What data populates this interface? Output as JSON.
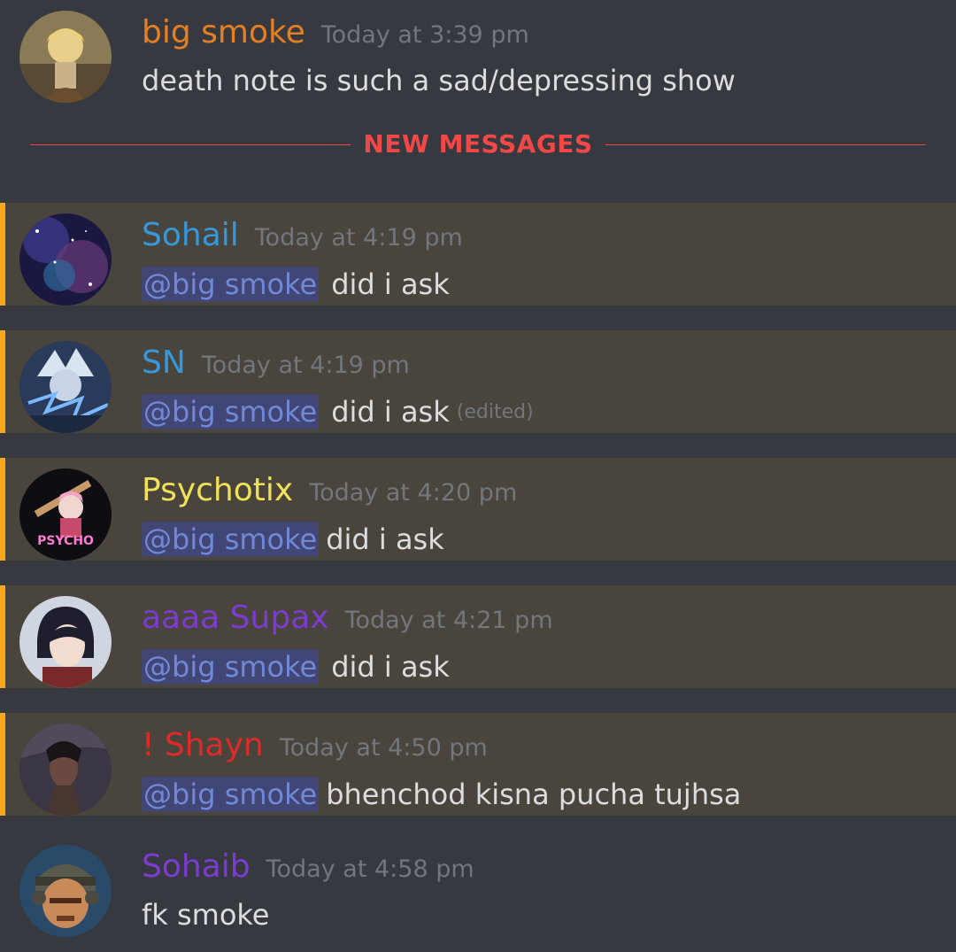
{
  "colors": {
    "background": "#36393f",
    "mention_background": "#49443c",
    "mention_bar": "#faa61a",
    "divider": "#f04747",
    "timestamp": "#72767d",
    "text": "#dcddde",
    "mention_pill_text": "#7289da"
  },
  "messages": [
    {
      "username": "big smoke",
      "username_color": "#e67e22",
      "timestamp": "Today at 3:39 pm",
      "text": "death note is such a sad/depressing show"
    },
    {
      "username": "Sohail",
      "username_color": "#3498db",
      "timestamp": "Today at 4:19 pm",
      "mention": "@big smoke",
      "text": "did i ask"
    },
    {
      "username": "SN",
      "username_color": "#3498db",
      "timestamp": "Today at 4:19 pm",
      "mention": "@big smoke",
      "text": "did i ask",
      "edited": "(edited)"
    },
    {
      "username": "Psychotix",
      "username_color": "#f1e05a",
      "timestamp": "Today at 4:20 pm",
      "mention": "@big smoke",
      "text": "did i ask",
      "avatar_text": "PSYCHO"
    },
    {
      "username": "aaaa Supax",
      "username_color": "#7e3bd1",
      "timestamp": "Today at 4:21 pm",
      "mention": "@big smoke",
      "text": "did i ask"
    },
    {
      "username": "! Shayn",
      "username_color": "#e02a2a",
      "timestamp": "Today at 4:50 pm",
      "mention": "@big smoke",
      "text": "bhenchod kisna pucha tujhsa"
    },
    {
      "username": "Sohaib",
      "username_color": "#7e3bd1",
      "timestamp": "Today at 4:58 pm",
      "text": "fk smoke"
    }
  ],
  "divider": {
    "label": "NEW MESSAGES"
  }
}
